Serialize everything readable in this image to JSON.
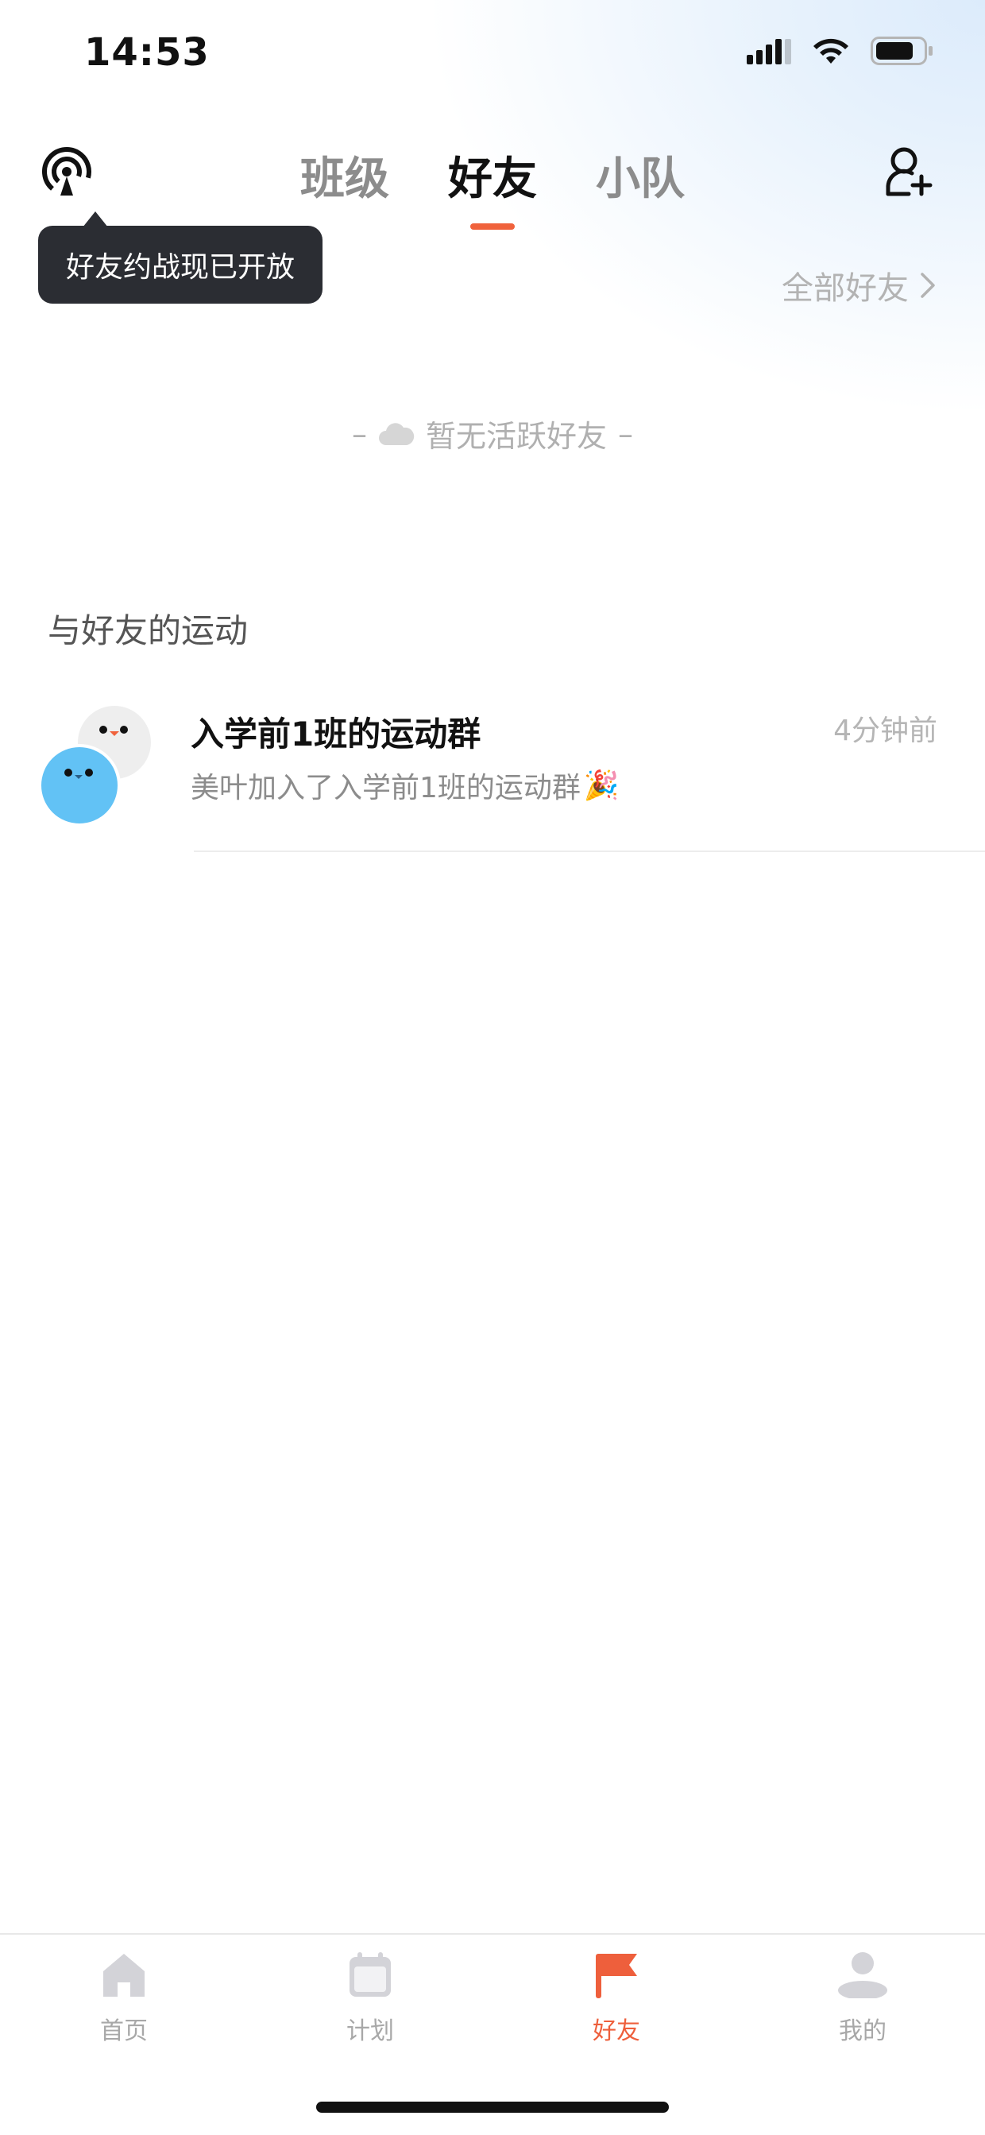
{
  "status_bar": {
    "time": "14:53"
  },
  "header": {
    "tabs": [
      {
        "label": "班级",
        "active": false
      },
      {
        "label": "好友",
        "active": true
      },
      {
        "label": "小队",
        "active": false
      }
    ],
    "left_icon": "broadcast-icon",
    "right_icon": "add-friend-icon"
  },
  "tooltip": {
    "text": "好友约战现已开放"
  },
  "all_friends_link": {
    "label": "全部好友"
  },
  "active_friends": {
    "empty_text": "暂无活跃好友"
  },
  "section": {
    "title": "与好友的运动"
  },
  "activity_list": [
    {
      "title": "入学前1班的运动群",
      "time": "4分钟前",
      "message": "美叶加入了入学前1班的运动群",
      "emoji": "🎉"
    }
  ],
  "bottom_nav": [
    {
      "label": "首页",
      "icon": "home-icon",
      "active": false
    },
    {
      "label": "计划",
      "icon": "calendar-icon",
      "active": false
    },
    {
      "label": "好友",
      "icon": "flag-icon",
      "active": true
    },
    {
      "label": "我的",
      "icon": "user-icon",
      "active": false
    }
  ],
  "colors": {
    "accent": "#f0623c",
    "tooltip_bg": "#2b2d33",
    "inactive": "#a8a8a8"
  }
}
